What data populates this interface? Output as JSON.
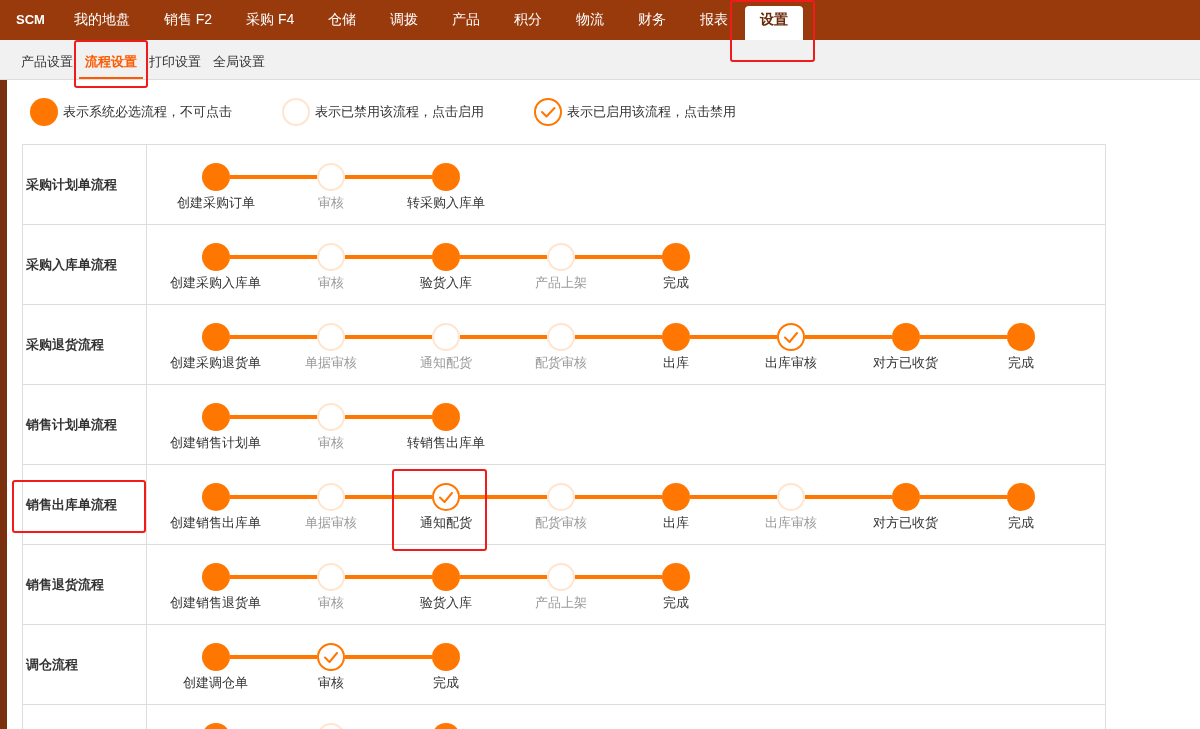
{
  "topbar": {
    "brand": "SCM",
    "tabs": [
      {
        "label": "我的地盘",
        "selected": false,
        "highlighted": false
      },
      {
        "label": "销售 F2",
        "selected": false,
        "highlighted": false
      },
      {
        "label": "采购 F4",
        "selected": false,
        "highlighted": false
      },
      {
        "label": "仓储",
        "selected": false,
        "highlighted": false
      },
      {
        "label": "调拨",
        "selected": false,
        "highlighted": false
      },
      {
        "label": "产品",
        "selected": false,
        "highlighted": false
      },
      {
        "label": "积分",
        "selected": false,
        "highlighted": false
      },
      {
        "label": "物流",
        "selected": false,
        "highlighted": false
      },
      {
        "label": "财务",
        "selected": false,
        "highlighted": false
      },
      {
        "label": "报表",
        "selected": false,
        "highlighted": false
      },
      {
        "label": "设置",
        "selected": true,
        "highlighted": true
      }
    ]
  },
  "subnav": {
    "items": [
      {
        "label": "产品设置",
        "selected": false,
        "highlighted": false
      },
      {
        "label": "流程设置",
        "selected": true,
        "highlighted": true
      },
      {
        "label": "打印设置",
        "selected": false,
        "highlighted": false
      },
      {
        "label": "全局设置",
        "selected": false,
        "highlighted": false
      }
    ]
  },
  "legend": [
    {
      "kind": "required",
      "text": "表示系统必选流程，不可点击"
    },
    {
      "kind": "disabled",
      "text": "表示已禁用该流程，点击启用"
    },
    {
      "kind": "enabled",
      "text": "表示已启用该流程，点击禁用"
    }
  ],
  "flows": [
    {
      "name": "采购计划单流程",
      "highlighted": false,
      "steps": [
        {
          "label": "创建采购订单",
          "kind": "required",
          "highlighted": false
        },
        {
          "label": "审核",
          "kind": "disabled",
          "highlighted": false
        },
        {
          "label": "转采购入库单",
          "kind": "required",
          "highlighted": false
        }
      ]
    },
    {
      "name": "采购入库单流程",
      "highlighted": false,
      "steps": [
        {
          "label": "创建采购入库单",
          "kind": "required",
          "highlighted": false
        },
        {
          "label": "审核",
          "kind": "disabled",
          "highlighted": false
        },
        {
          "label": "验货入库",
          "kind": "required",
          "highlighted": false
        },
        {
          "label": "产品上架",
          "kind": "disabled",
          "highlighted": false
        },
        {
          "label": "完成",
          "kind": "required",
          "highlighted": false
        }
      ]
    },
    {
      "name": "采购退货流程",
      "highlighted": false,
      "steps": [
        {
          "label": "创建采购退货单",
          "kind": "required",
          "highlighted": false
        },
        {
          "label": "单据审核",
          "kind": "disabled",
          "highlighted": false
        },
        {
          "label": "通知配货",
          "kind": "disabled",
          "highlighted": false
        },
        {
          "label": "配货审核",
          "kind": "disabled",
          "highlighted": false
        },
        {
          "label": "出库",
          "kind": "required",
          "highlighted": false
        },
        {
          "label": "出库审核",
          "kind": "enabled",
          "highlighted": false
        },
        {
          "label": "对方已收货",
          "kind": "required",
          "highlighted": false
        },
        {
          "label": "完成",
          "kind": "required",
          "highlighted": false
        }
      ]
    },
    {
      "name": "销售计划单流程",
      "highlighted": false,
      "steps": [
        {
          "label": "创建销售计划单",
          "kind": "required",
          "highlighted": false
        },
        {
          "label": "审核",
          "kind": "disabled",
          "highlighted": false
        },
        {
          "label": "转销售出库单",
          "kind": "required",
          "highlighted": false
        }
      ]
    },
    {
      "name": "销售出库单流程",
      "highlighted": true,
      "steps": [
        {
          "label": "创建销售出库单",
          "kind": "required",
          "highlighted": false
        },
        {
          "label": "单据审核",
          "kind": "disabled",
          "highlighted": false
        },
        {
          "label": "通知配货",
          "kind": "enabled",
          "highlighted": true
        },
        {
          "label": "配货审核",
          "kind": "disabled",
          "highlighted": false
        },
        {
          "label": "出库",
          "kind": "required",
          "highlighted": false
        },
        {
          "label": "出库审核",
          "kind": "disabled",
          "highlighted": false
        },
        {
          "label": "对方已收货",
          "kind": "required",
          "highlighted": false
        },
        {
          "label": "完成",
          "kind": "required",
          "highlighted": false
        }
      ]
    },
    {
      "name": "销售退货流程",
      "highlighted": false,
      "steps": [
        {
          "label": "创建销售退货单",
          "kind": "required",
          "highlighted": false
        },
        {
          "label": "审核",
          "kind": "disabled",
          "highlighted": false
        },
        {
          "label": "验货入库",
          "kind": "required",
          "highlighted": false
        },
        {
          "label": "产品上架",
          "kind": "disabled",
          "highlighted": false
        },
        {
          "label": "完成",
          "kind": "required",
          "highlighted": false
        }
      ]
    },
    {
      "name": "调仓流程",
      "highlighted": false,
      "steps": [
        {
          "label": "创建调仓单",
          "kind": "required",
          "highlighted": false
        },
        {
          "label": "审核",
          "kind": "enabled",
          "highlighted": false
        },
        {
          "label": "完成",
          "kind": "required",
          "highlighted": false
        }
      ]
    },
    {
      "highlighted": false,
      "steps": [
        {
          "kind": "required",
          "highlighted": false
        },
        {
          "kind": "disabled",
          "highlighted": false
        },
        {
          "kind": "required",
          "highlighted": false
        }
      ]
    }
  ]
}
